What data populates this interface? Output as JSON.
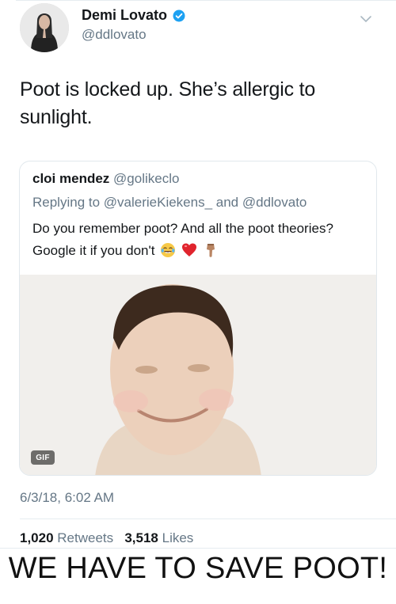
{
  "tweet": {
    "author": {
      "name": "Demi Lovato",
      "handle": "@ddlovato",
      "verified": true
    },
    "text": "Poot is locked up. She’s allergic to sunlight.",
    "quoted": {
      "name": "cloi mendez",
      "handle": "@golikeclo",
      "replying": "Replying to @valerieKiekens_ and @ddlovato",
      "text": "Do you remember poot? And all the poot theories? Google it if you don't",
      "emojis": [
        "tears-of-joy-emoji",
        "red-heart-emoji",
        "pointing-down-emoji"
      ],
      "media": {
        "type": "gif",
        "badge": "GIF"
      }
    },
    "timestamp": "6/3/18, 6:02 AM",
    "retweets": "1,020",
    "retweets_label": "Retweets",
    "likes": "3,518",
    "likes_label": "Likes"
  },
  "caption": "WE HAVE TO SAVE POOT!",
  "colors": {
    "verified": "#1da1f2",
    "secondary_text": "#657786",
    "border": "#e1e8ed"
  }
}
